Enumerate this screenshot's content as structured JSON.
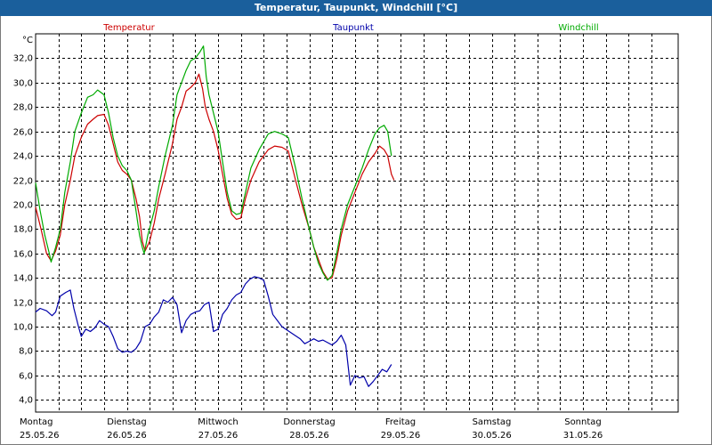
{
  "window": {
    "title": "Temperatur, Taupunkt, Windchill [°C]"
  },
  "colors": {
    "temperature": "#cc0000",
    "dewpoint": "#0000aa",
    "windchill": "#00aa00",
    "grid": "#000000",
    "titlebar": "#1a5f9c"
  },
  "chart_data": {
    "type": "line",
    "title": "Temperatur, Taupunkt, Windchill [°C]",
    "ylabel": "°C",
    "ylim": [
      3.0,
      34.0
    ],
    "yticks": [
      4.0,
      6.0,
      8.0,
      10.0,
      12.0,
      14.0,
      16.0,
      18.0,
      20.0,
      22.0,
      24.0,
      26.0,
      28.0,
      30.0,
      32.0
    ],
    "ytick_labels": [
      "4,0",
      "6,0",
      "8,0",
      "10,0",
      "12,0",
      "14,0",
      "16,0",
      "18,0",
      "20,0",
      "22,0",
      "24,0",
      "26,0",
      "28,0",
      "30,0",
      "32,0"
    ],
    "xlim": [
      0,
      7
    ],
    "x_unit": "days since Montag 25.05.26 00:00",
    "days": [
      {
        "name": "Montag",
        "date": "25.05.26"
      },
      {
        "name": "Dienstag",
        "date": "26.05.26"
      },
      {
        "name": "Mittwoch",
        "date": "27.05.26"
      },
      {
        "name": "Donnerstag",
        "date": "28.05.26"
      },
      {
        "name": "Freitag",
        "date": "29.05.26"
      },
      {
        "name": "Samstag",
        "date": "30.05.26"
      },
      {
        "name": "Sonntag",
        "date": "31.05.26"
      }
    ],
    "grid": true,
    "legend_placement": "top",
    "series": [
      {
        "name": "Temperatur",
        "color": "#cc0000",
        "points": [
          [
            0,
            19.8
          ],
          [
            0.06,
            18.0
          ],
          [
            0.12,
            16.0
          ],
          [
            0.17,
            15.4
          ],
          [
            0.22,
            16.2
          ],
          [
            0.27,
            17.5
          ],
          [
            0.32,
            20.0
          ],
          [
            0.38,
            22.0
          ],
          [
            0.43,
            24.0
          ],
          [
            0.5,
            25.5
          ],
          [
            0.57,
            26.6
          ],
          [
            0.63,
            27.0
          ],
          [
            0.68,
            27.3
          ],
          [
            0.75,
            27.4
          ],
          [
            0.8,
            26.5
          ],
          [
            0.85,
            25.0
          ],
          [
            0.9,
            23.5
          ],
          [
            0.95,
            22.8
          ],
          [
            1.0,
            22.5
          ],
          [
            1.05,
            22.0
          ],
          [
            1.1,
            20.5
          ],
          [
            1.14,
            19.0
          ],
          [
            1.17,
            17.0
          ],
          [
            1.2,
            16.2
          ],
          [
            1.25,
            17.0
          ],
          [
            1.3,
            18.5
          ],
          [
            1.35,
            20.5
          ],
          [
            1.42,
            22.5
          ],
          [
            1.5,
            25.0
          ],
          [
            1.55,
            27.0
          ],
          [
            1.6,
            28.0
          ],
          [
            1.65,
            29.3
          ],
          [
            1.7,
            29.6
          ],
          [
            1.75,
            30.0
          ],
          [
            1.79,
            30.7
          ],
          [
            1.83,
            29.5
          ],
          [
            1.86,
            28.0
          ],
          [
            1.9,
            27.0
          ],
          [
            1.95,
            26.0
          ],
          [
            2.0,
            24.5
          ],
          [
            2.05,
            22.5
          ],
          [
            2.1,
            20.5
          ],
          [
            2.15,
            19.2
          ],
          [
            2.2,
            18.8
          ],
          [
            2.25,
            18.9
          ],
          [
            2.3,
            20.5
          ],
          [
            2.36,
            22.0
          ],
          [
            2.45,
            23.5
          ],
          [
            2.55,
            24.5
          ],
          [
            2.62,
            24.8
          ],
          [
            2.7,
            24.7
          ],
          [
            2.77,
            24.4
          ],
          [
            2.85,
            22.0
          ],
          [
            2.92,
            20.0
          ],
          [
            3.0,
            18.0
          ],
          [
            3.05,
            16.5
          ],
          [
            3.1,
            15.5
          ],
          [
            3.15,
            14.5
          ],
          [
            3.2,
            13.9
          ],
          [
            3.25,
            14.0
          ],
          [
            3.3,
            15.5
          ],
          [
            3.35,
            17.5
          ],
          [
            3.42,
            19.5
          ],
          [
            3.5,
            21.0
          ],
          [
            3.58,
            22.5
          ],
          [
            3.65,
            23.5
          ],
          [
            3.72,
            24.2
          ],
          [
            3.77,
            24.8
          ],
          [
            3.82,
            24.5
          ],
          [
            3.86,
            24.0
          ],
          [
            3.9,
            22.5
          ],
          [
            3.93,
            22.0
          ]
        ]
      },
      {
        "name": "Taupunkt",
        "color": "#0000aa",
        "points": [
          [
            0,
            11.2
          ],
          [
            0.05,
            11.5
          ],
          [
            0.12,
            11.3
          ],
          [
            0.18,
            10.9
          ],
          [
            0.22,
            11.2
          ],
          [
            0.27,
            12.5
          ],
          [
            0.33,
            12.8
          ],
          [
            0.38,
            13.0
          ],
          [
            0.42,
            11.5
          ],
          [
            0.47,
            10.0
          ],
          [
            0.5,
            9.2
          ],
          [
            0.55,
            9.8
          ],
          [
            0.6,
            9.6
          ],
          [
            0.65,
            9.9
          ],
          [
            0.7,
            10.5
          ],
          [
            0.75,
            10.2
          ],
          [
            0.8,
            10.0
          ],
          [
            0.85,
            9.2
          ],
          [
            0.9,
            8.2
          ],
          [
            0.95,
            7.9
          ],
          [
            1.0,
            8.0
          ],
          [
            1.05,
            7.9
          ],
          [
            1.1,
            8.2
          ],
          [
            1.15,
            8.8
          ],
          [
            1.2,
            10.0
          ],
          [
            1.25,
            10.2
          ],
          [
            1.3,
            10.8
          ],
          [
            1.35,
            11.2
          ],
          [
            1.4,
            12.2
          ],
          [
            1.45,
            12.0
          ],
          [
            1.5,
            12.4
          ],
          [
            1.55,
            11.8
          ],
          [
            1.6,
            9.5
          ],
          [
            1.65,
            10.5
          ],
          [
            1.7,
            11.0
          ],
          [
            1.75,
            11.2
          ],
          [
            1.8,
            11.3
          ],
          [
            1.85,
            11.8
          ],
          [
            1.9,
            12.0
          ],
          [
            1.95,
            9.6
          ],
          [
            2.0,
            9.8
          ],
          [
            2.05,
            11.0
          ],
          [
            2.1,
            11.5
          ],
          [
            2.15,
            12.2
          ],
          [
            2.2,
            12.6
          ],
          [
            2.25,
            12.8
          ],
          [
            2.3,
            13.5
          ],
          [
            2.35,
            13.9
          ],
          [
            2.4,
            14.1
          ],
          [
            2.45,
            14.0
          ],
          [
            2.5,
            13.8
          ],
          [
            2.55,
            12.5
          ],
          [
            2.6,
            11.0
          ],
          [
            2.7,
            10.0
          ],
          [
            2.8,
            9.5
          ],
          [
            2.9,
            9.0
          ],
          [
            2.95,
            8.6
          ],
          [
            3.0,
            8.8
          ],
          [
            3.05,
            9.0
          ],
          [
            3.1,
            8.8
          ],
          [
            3.15,
            8.9
          ],
          [
            3.2,
            8.7
          ],
          [
            3.25,
            8.5
          ],
          [
            3.3,
            8.8
          ],
          [
            3.35,
            9.3
          ],
          [
            3.4,
            8.5
          ],
          [
            3.45,
            5.2
          ],
          [
            3.5,
            6.0
          ],
          [
            3.55,
            5.8
          ],
          [
            3.6,
            5.9
          ],
          [
            3.65,
            5.1
          ],
          [
            3.7,
            5.5
          ],
          [
            3.75,
            6.0
          ],
          [
            3.8,
            6.5
          ],
          [
            3.85,
            6.3
          ],
          [
            3.9,
            6.9
          ]
        ]
      },
      {
        "name": "Windchill",
        "color": "#00aa00",
        "points": [
          [
            0,
            21.8
          ],
          [
            0.05,
            19.5
          ],
          [
            0.1,
            17.5
          ],
          [
            0.15,
            16.0
          ],
          [
            0.17,
            15.3
          ],
          [
            0.22,
            16.5
          ],
          [
            0.27,
            18.0
          ],
          [
            0.32,
            21.0
          ],
          [
            0.38,
            23.5
          ],
          [
            0.43,
            26.0
          ],
          [
            0.5,
            27.5
          ],
          [
            0.57,
            28.8
          ],
          [
            0.63,
            29.0
          ],
          [
            0.68,
            29.4
          ],
          [
            0.75,
            29.0
          ],
          [
            0.8,
            27.5
          ],
          [
            0.85,
            25.5
          ],
          [
            0.9,
            24.0
          ],
          [
            0.95,
            23.2
          ],
          [
            1.0,
            22.8
          ],
          [
            1.05,
            22.0
          ],
          [
            1.1,
            19.5
          ],
          [
            1.14,
            17.5
          ],
          [
            1.17,
            16.5
          ],
          [
            1.19,
            16.0
          ],
          [
            1.23,
            17.5
          ],
          [
            1.3,
            19.5
          ],
          [
            1.35,
            21.5
          ],
          [
            1.42,
            24.0
          ],
          [
            1.5,
            26.5
          ],
          [
            1.55,
            29.0
          ],
          [
            1.6,
            30.0
          ],
          [
            1.65,
            31.0
          ],
          [
            1.7,
            31.8
          ],
          [
            1.75,
            32.0
          ],
          [
            1.8,
            32.5
          ],
          [
            1.84,
            33.0
          ],
          [
            1.87,
            30.5
          ],
          [
            1.9,
            29.0
          ],
          [
            1.95,
            27.5
          ],
          [
            2.0,
            26.0
          ],
          [
            2.05,
            23.5
          ],
          [
            2.1,
            21.0
          ],
          [
            2.15,
            19.5
          ],
          [
            2.2,
            19.2
          ],
          [
            2.25,
            19.3
          ],
          [
            2.3,
            21.0
          ],
          [
            2.36,
            23.0
          ],
          [
            2.45,
            24.5
          ],
          [
            2.55,
            25.8
          ],
          [
            2.62,
            26.0
          ],
          [
            2.7,
            25.8
          ],
          [
            2.77,
            25.5
          ],
          [
            2.85,
            23.0
          ],
          [
            2.92,
            20.5
          ],
          [
            3.0,
            18.0
          ],
          [
            3.05,
            16.5
          ],
          [
            3.1,
            15.2
          ],
          [
            3.15,
            14.4
          ],
          [
            3.2,
            13.8
          ],
          [
            3.25,
            14.2
          ],
          [
            3.3,
            16.0
          ],
          [
            3.35,
            18.0
          ],
          [
            3.42,
            20.0
          ],
          [
            3.5,
            21.5
          ],
          [
            3.58,
            23.0
          ],
          [
            3.65,
            24.5
          ],
          [
            3.72,
            25.8
          ],
          [
            3.77,
            26.3
          ],
          [
            3.82,
            26.5
          ],
          [
            3.86,
            26.0
          ],
          [
            3.9,
            24.0
          ]
        ]
      }
    ]
  }
}
